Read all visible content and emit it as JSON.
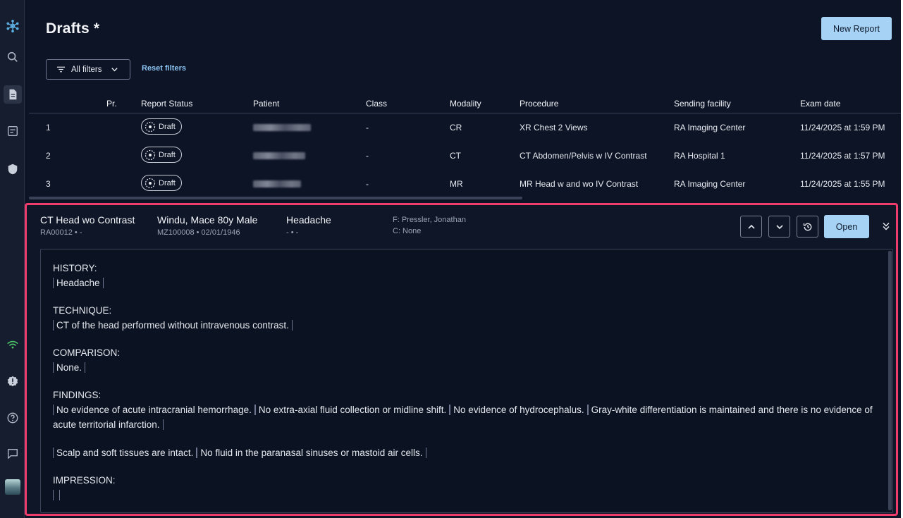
{
  "page": {
    "title": "Drafts *",
    "new_report_label": "New Report"
  },
  "filters": {
    "all_filters_label": "All filters",
    "reset_label": "Reset filters"
  },
  "sidebar": {
    "icons": [
      "app-logo-icon",
      "search-icon",
      "document-icon",
      "report-list-icon",
      "shield-icon",
      "wifi-icon",
      "alert-icon",
      "help-icon",
      "chat-icon"
    ]
  },
  "table": {
    "columns": [
      "Pr.",
      "Report Status",
      "Patient",
      "Class",
      "Modality",
      "Procedure",
      "Sending facility",
      "Exam date"
    ],
    "rows": [
      {
        "num": "1",
        "status": "Draft",
        "class": "-",
        "modality": "CR",
        "procedure": "XR Chest 2 Views",
        "facility": "RA Imaging Center",
        "date": "11/24/2025 at 1:59 PM"
      },
      {
        "num": "2",
        "status": "Draft",
        "class": "-",
        "modality": "CT",
        "procedure": "CT Abdomen/Pelvis w IV Contrast",
        "facility": "RA Hospital 1",
        "date": "11/24/2025 at 1:57 PM"
      },
      {
        "num": "3",
        "status": "Draft",
        "class": "-",
        "modality": "MR",
        "procedure": "MR Head w and wo IV Contrast",
        "facility": "RA Imaging Center",
        "date": "11/24/2025 at 1:55 PM"
      }
    ]
  },
  "preview": {
    "procedure": "CT Head wo Contrast",
    "accession": "RA00012 • -",
    "patient": "Windu, Mace 80y Male",
    "patient_sub": "MZ100008 • 02/01/1946",
    "reason": "Headache",
    "reason_sub": "- • -",
    "from": "F: Pressler, Jonathan",
    "cc": "C: None",
    "open_label": "Open",
    "report": {
      "history_label": "HISTORY:",
      "history": [
        "Headache"
      ],
      "technique_label": "TECHNIQUE:",
      "technique": [
        "CT of the head performed without intravenous contrast."
      ],
      "comparison_label": "COMPARISON:",
      "comparison": [
        "None."
      ],
      "findings_label": "FINDINGS:",
      "findings_1": [
        "No evidence of acute intracranial hemorrhage.",
        "No extra-axial fluid collection or midline shift.",
        "No evidence of hydrocephalus.",
        "Gray-white differentiation is maintained and there is no evidence of acute territorial infarction."
      ],
      "findings_2": [
        "Scalp and soft tissues are intact.",
        "No fluid in the paranasal sinuses or mastoid air cells."
      ],
      "impression_label": "IMPRESSION:"
    }
  },
  "colors": {
    "accent": "#a6d3f5",
    "highlight": "#ee3d6d",
    "background": "#0d1426",
    "link": "#8cc4f2"
  }
}
